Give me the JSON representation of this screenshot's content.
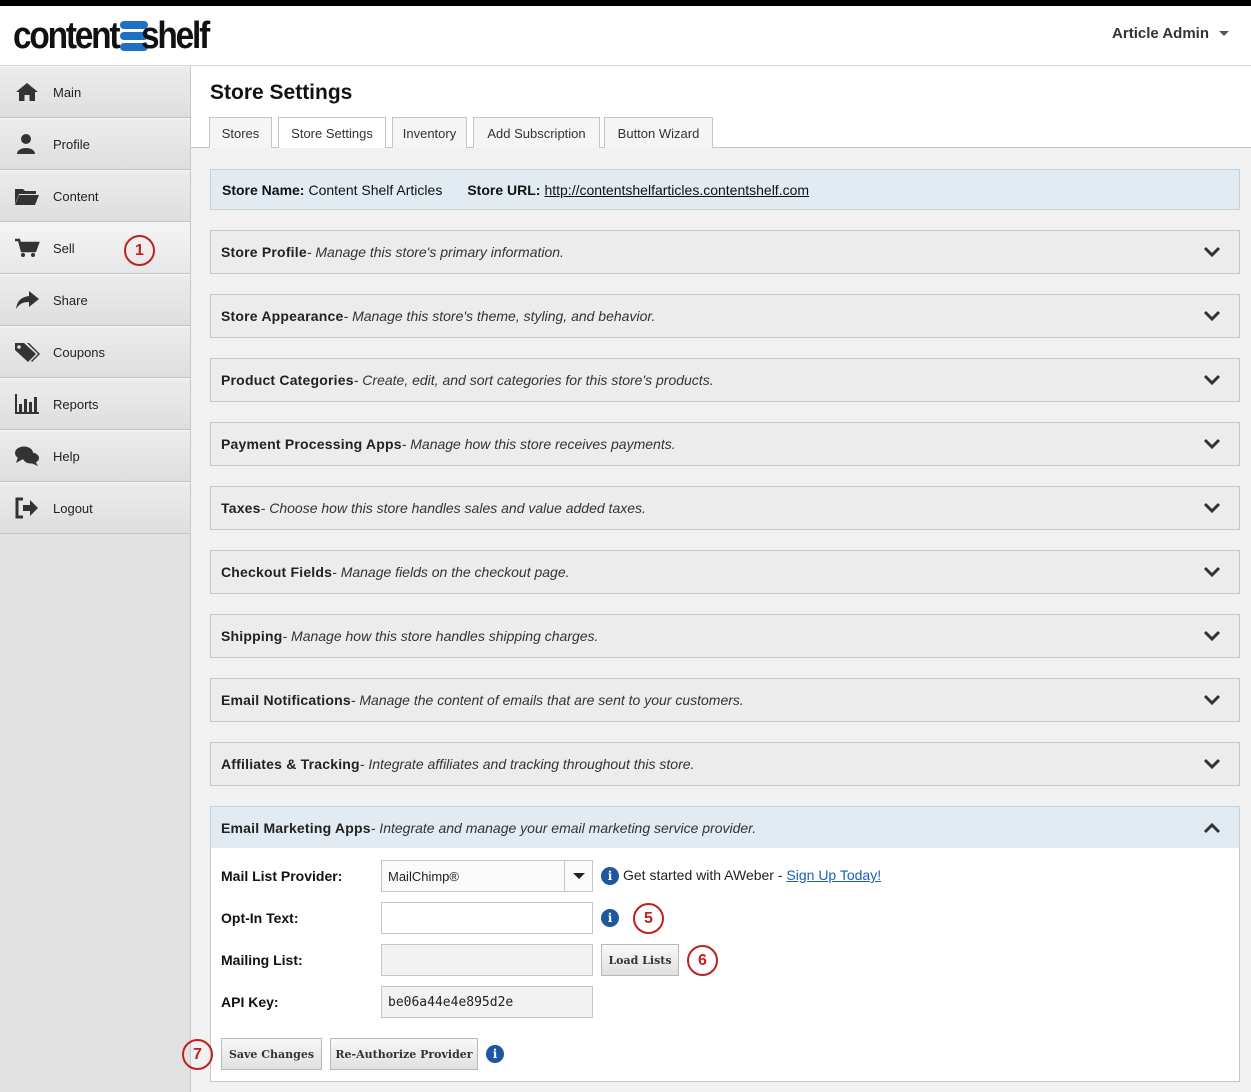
{
  "header": {
    "logo_part1": "content",
    "logo_part2": "shelf",
    "user_menu": "Article Admin"
  },
  "sidebar": {
    "items": [
      {
        "label": "Main",
        "icon": "home-icon"
      },
      {
        "label": "Profile",
        "icon": "user-icon"
      },
      {
        "label": "Content",
        "icon": "folder-icon"
      },
      {
        "label": "Sell",
        "icon": "cart-icon"
      },
      {
        "label": "Share",
        "icon": "share-icon"
      },
      {
        "label": "Coupons",
        "icon": "tags-icon"
      },
      {
        "label": "Reports",
        "icon": "bar-chart-icon"
      },
      {
        "label": "Help",
        "icon": "chat-icon"
      },
      {
        "label": "Logout",
        "icon": "logout-icon"
      }
    ],
    "active": "Sell"
  },
  "page": {
    "title": "Store Settings",
    "tabs": [
      "Stores",
      "Store Settings",
      "Inventory",
      "Add Subscription",
      "Button Wizard"
    ],
    "active_tab": "Store Settings"
  },
  "store": {
    "name_label": "Store Name:",
    "name": "Content Shelf Articles",
    "url_label": "Store URL:",
    "url": "http://contentshelfarticles.contentshelf.com"
  },
  "sections": [
    {
      "title": "Store Profile",
      "desc": " - Manage this store's primary information."
    },
    {
      "title": "Store Appearance",
      "desc": " - Manage this store's theme, styling, and behavior."
    },
    {
      "title": "Product Categories",
      "desc": " - Create, edit, and sort categories for this store's products."
    },
    {
      "title": "Payment Processing Apps",
      "desc": " - Manage how this store receives payments."
    },
    {
      "title": "Taxes",
      "desc": " - Choose how this store handles sales and value added taxes."
    },
    {
      "title": "Checkout Fields",
      "desc": " - Manage fields on the checkout page."
    },
    {
      "title": "Shipping",
      "desc": " - Manage how this store handles shipping charges."
    },
    {
      "title": "Email Notifications",
      "desc": " - Manage the content of emails that are sent to your customers."
    },
    {
      "title": "Affiliates & Tracking",
      "desc": " - Integrate affiliates and tracking throughout this store."
    },
    {
      "title": "Email Marketing Apps",
      "desc": " - Integrate and manage your email marketing service provider."
    }
  ],
  "email_marketing": {
    "provider_label": "Mail List Provider:",
    "provider_value": "MailChimp®",
    "hint_text": "Get started with AWeber - ",
    "hint_link": "Sign Up Today!",
    "optin_label": "Opt-In Text:",
    "optin_value": "",
    "mailing_label": "Mailing List:",
    "mailing_value": "",
    "load_lists": "Load Lists",
    "api_label": "API Key:",
    "api_value": "be06a44e4e895d2e",
    "save_button": "Save Changes",
    "reauth_button": "Re-Authorize Provider",
    "info_glyph": "i"
  },
  "annotations": [
    "1",
    "5",
    "6",
    "7"
  ],
  "colors": {
    "accent_blue": "#1e56a0",
    "annotation_red": "#c02020",
    "logo_blue": "#1f6fc4"
  }
}
